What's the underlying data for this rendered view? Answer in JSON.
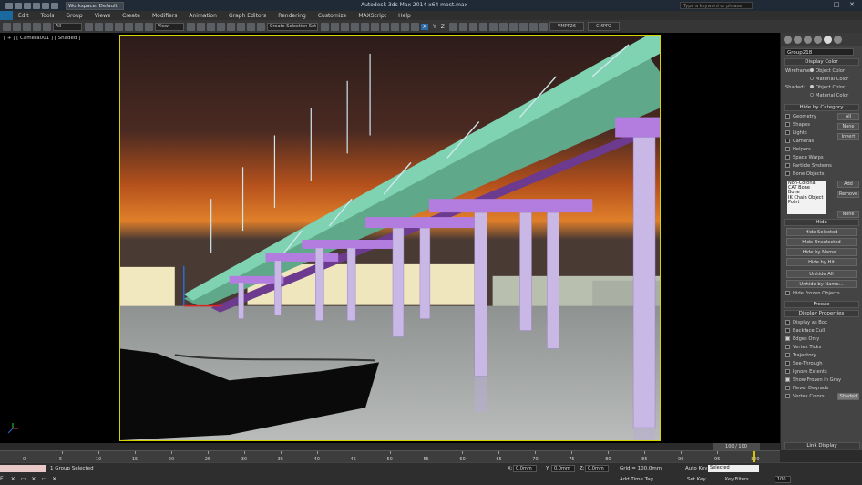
{
  "titlebar": {
    "workspace": "Workspace: Default",
    "app_title": "Autodesk 3ds Max  2014 x64     most.max",
    "search_placeholder": "Type a keyword or phrase"
  },
  "menu": [
    "Edit",
    "Tools",
    "Group",
    "Views",
    "Create",
    "Modifiers",
    "Animation",
    "Graph Editors",
    "Rendering",
    "Customize",
    "MAXScript",
    "Help"
  ],
  "toolbar": {
    "filter_select": "All",
    "view_select": "View",
    "selection_set": "Create Selection Set",
    "axes": [
      "X",
      "Y",
      "Z"
    ],
    "tabs": [
      "VMPP26",
      "CMPP2"
    ]
  },
  "viewport": {
    "label": "[ + ] [ Camera001 ] [ Shaded ]"
  },
  "command_panel": {
    "object_name": "Group218",
    "display_color": {
      "title": "Display Color",
      "wireframe_label": "Wireframe:",
      "shaded_label": "Shaded:",
      "object_color": "Object Color",
      "material_color": "Material Color"
    },
    "hide_by_category": {
      "title": "Hide by Category",
      "items": [
        "Geometry",
        "Shapes",
        "Lights",
        "Cameras",
        "Helpers",
        "Space Warps",
        "Particle Systems",
        "Bone Objects"
      ],
      "buttons": [
        "All",
        "None",
        "Invert"
      ],
      "list": [
        "Non-Corona",
        "CAT Bone",
        "Bone",
        "IK Chain Object",
        "Point"
      ],
      "list_buttons": [
        "Add",
        "Remove",
        "None"
      ]
    },
    "hide": {
      "title": "Hide",
      "buttons": [
        "Hide Selected",
        "Hide Unselected",
        "Hide by Name...",
        "Hide by Hit",
        "Unhide All",
        "Unhide by Name..."
      ],
      "frozen": "Hide Frozen Objects"
    },
    "freeze": {
      "title": "Freeze"
    },
    "display_properties": {
      "title": "Display Properties",
      "items": [
        {
          "label": "Display as Box",
          "checked": false
        },
        {
          "label": "Backface Cull",
          "checked": false
        },
        {
          "label": "Edges Only",
          "checked": true
        },
        {
          "label": "Vertex Ticks",
          "checked": false
        },
        {
          "label": "Trajectory",
          "checked": false
        },
        {
          "label": "See-Through",
          "checked": false
        },
        {
          "label": "Ignore Extents",
          "checked": false
        },
        {
          "label": "Show Frozen in Gray",
          "checked": true
        },
        {
          "label": "Never Degrade",
          "checked": false
        },
        {
          "label": "Vertex Colors",
          "checked": false
        }
      ],
      "shaded_button": "Shaded"
    },
    "link_display": {
      "title": "Link Display"
    }
  },
  "timeline": {
    "slider": "100 / 100",
    "ticks": [
      "0",
      "5",
      "10",
      "15",
      "20",
      "25",
      "30",
      "35",
      "40",
      "45",
      "50",
      "55",
      "60",
      "65",
      "70",
      "75",
      "80",
      "85",
      "90",
      "95",
      "100"
    ]
  },
  "status": {
    "selection": "1 Group Selected",
    "x_label": "X:",
    "x_value": "0,0mm",
    "y_label": "Y:",
    "y_value": "0,0mm",
    "z_label": "Z:",
    "z_value": "0,0mm",
    "grid": "Grid = 100,0mm",
    "add_time_tag": "Add Time Tag",
    "auto_key": "Auto Key",
    "set_key": "Set Key",
    "key_select": "Selected",
    "key_filters": "Key Filters...",
    "frame": "100"
  }
}
